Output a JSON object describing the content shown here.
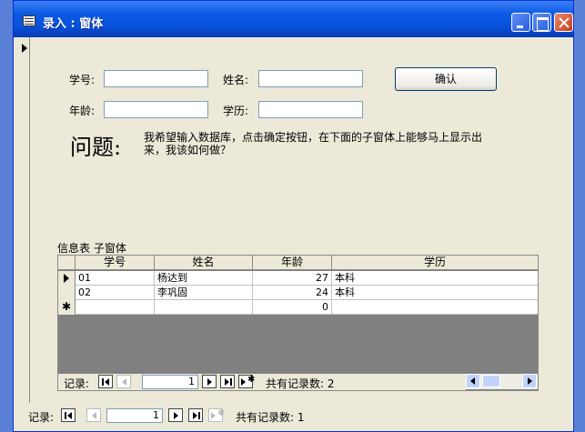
{
  "window": {
    "title": "录入 : 窗体"
  },
  "form": {
    "labels": {
      "student_id": "学号:",
      "name": "姓名:",
      "age": "年龄:",
      "education": "学历:"
    },
    "values": {
      "student_id": "",
      "name": "",
      "age": "",
      "education": ""
    },
    "confirm_label": "确认",
    "question_heading": "问题:",
    "question_text": "我希望输入数据库，点击确定按钮，在下面的子窗体上能够马上显示出来，我该如何做？"
  },
  "subform": {
    "label": "信息表 子窗体",
    "columns": [
      "学号",
      "姓名",
      "年龄",
      "学历"
    ],
    "rows": [
      [
        "01",
        "杨达到",
        "27",
        "本科"
      ],
      [
        "02",
        "李巩固",
        "24",
        "本科"
      ]
    ],
    "new_row_age": "0",
    "nav": {
      "records_label": "记录:",
      "current": "1",
      "total_label": "共有记录数: 2"
    }
  },
  "main_nav": {
    "records_label": "记录:",
    "current": "1",
    "total_label": "共有记录数: 1"
  }
}
